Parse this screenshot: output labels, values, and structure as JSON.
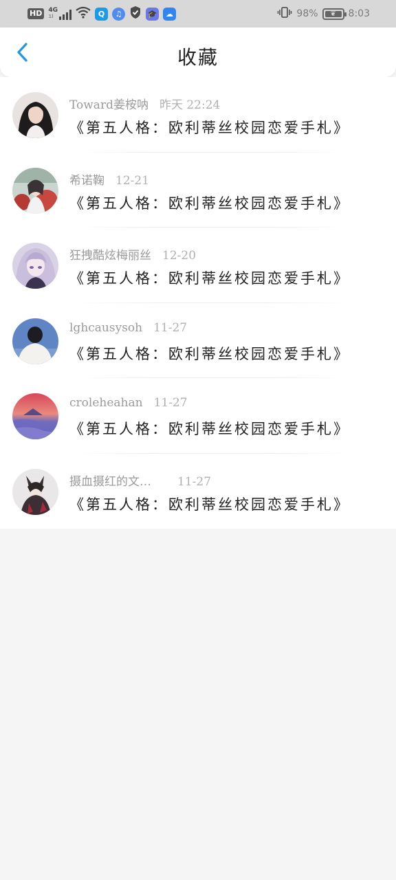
{
  "status_bar": {
    "hd": "HD",
    "network": "4G",
    "network_sub": "1l",
    "battery_percent_text": "98%",
    "battery_level": 0.98,
    "time": "8:03",
    "apps": [
      {
        "name": "search-app-icon",
        "glyph": "Q",
        "color": "#1a9be8"
      },
      {
        "name": "music-app-icon",
        "glyph": "♫",
        "color": "#4f8bf0"
      },
      {
        "name": "shield-app-icon",
        "glyph": "✔",
        "color": "#4a4a4a"
      },
      {
        "name": "education-app-icon",
        "glyph": "🎓",
        "color": "#6b78e6"
      },
      {
        "name": "cloud-app-icon",
        "glyph": "☁",
        "color": "#2f86f2"
      }
    ]
  },
  "header": {
    "title": "收藏",
    "accent_color": "#2196e8"
  },
  "items": [
    {
      "author": "Toward姜桉呐",
      "date": "昨天 22:24",
      "title": "《第五人格：欧利蒂丝校园恋爱手札》"
    },
    {
      "author": "希诺鞠",
      "date": "12-21",
      "title": "《第五人格：欧利蒂丝校园恋爱手札》"
    },
    {
      "author": "狂拽酷炫梅丽丝",
      "date": "12-20",
      "title": "《第五人格：欧利蒂丝校园恋爱手札》"
    },
    {
      "author": "lghcausysoh",
      "date": "11-27",
      "title": "《第五人格：欧利蒂丝校园恋爱手札》"
    },
    {
      "author": "croleheahan",
      "date": "11-27",
      "title": "《第五人格：欧利蒂丝校园恋爱手札》"
    },
    {
      "author": "摄血摄红的文…",
      "date": "11-27",
      "title": "《第五人格：欧利蒂丝校园恋爱手札》"
    }
  ]
}
